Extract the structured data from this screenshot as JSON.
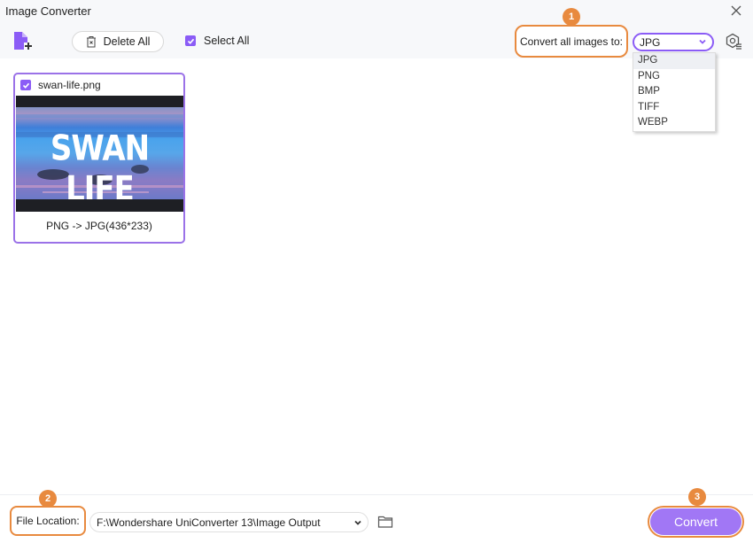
{
  "window": {
    "title": "Image Converter",
    "close_icon": "close-icon"
  },
  "toolbar": {
    "add_icon": "add-file-icon",
    "delete_all_label": "Delete All",
    "select_all_label": "Select All",
    "select_all_checked": true,
    "convert_all_label": "Convert all images to:",
    "format_selected": "JPG",
    "settings_icon": "settings-icon"
  },
  "format_dropdown": {
    "options": [
      "JPG",
      "PNG",
      "BMP",
      "TIFF",
      "WEBP"
    ],
    "selected": "JPG"
  },
  "badges": {
    "b1": "1",
    "b2": "2",
    "b3": "3"
  },
  "files": [
    {
      "name": "swan-life.png",
      "checked": true,
      "thumbnail_text": "SWAN LIFE",
      "conversion": "PNG -> JPG(436*233)"
    }
  ],
  "footer": {
    "file_location_label": "File Location:",
    "path_value": "F:\\Wondershare UniConverter 13\\Image Output",
    "folder_icon": "folder-icon",
    "convert_label": "Convert"
  },
  "colors": {
    "accent_purple": "#8b5cf6",
    "convert_button": "#a177f5",
    "highlight_orange": "#e88a3f"
  }
}
